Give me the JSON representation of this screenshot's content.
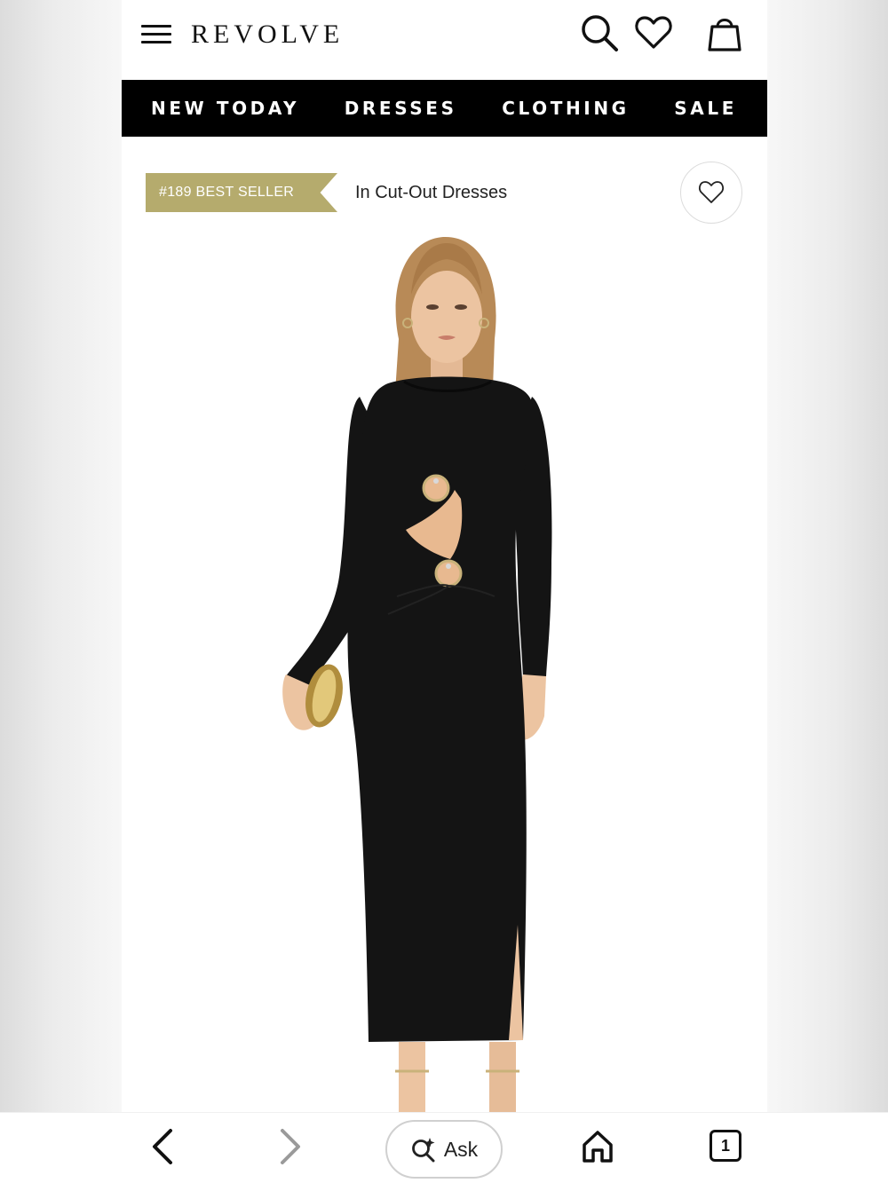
{
  "header": {
    "logo": "REVOLVE"
  },
  "nav": {
    "items": [
      "NEW TODAY",
      "DRESSES",
      "CLOTHING",
      "SALE"
    ]
  },
  "badge": {
    "rank_label": "#189 BEST SELLER",
    "category": "In Cut-Out Dresses",
    "color": "#b5ab6d"
  },
  "bottom_bar": {
    "ask_label": "Ask",
    "tab_count": "1"
  },
  "colors": {
    "nav_background": "#000000",
    "nav_text": "#ffffff",
    "dress": "#141414"
  }
}
